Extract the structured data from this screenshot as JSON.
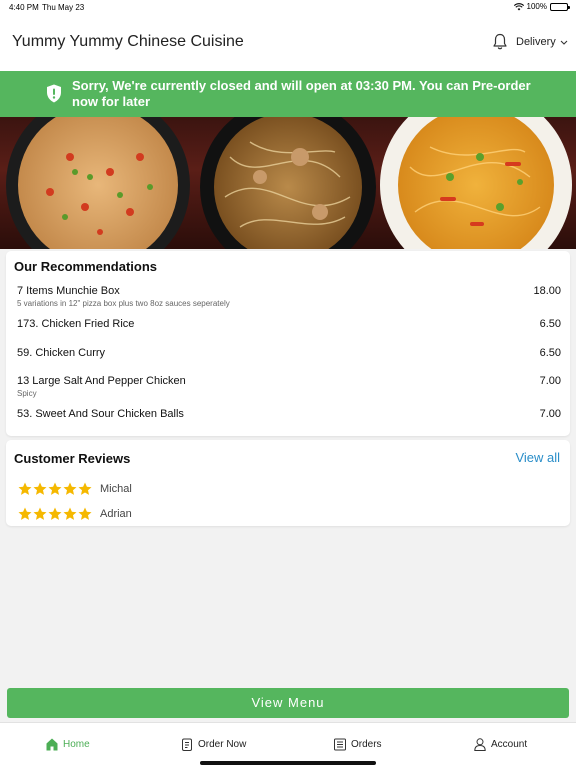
{
  "status_bar": {
    "time": "4:40 PM",
    "date": "Thu May 23",
    "battery": "100%"
  },
  "header": {
    "title": "Yummy Yummy Chinese Cuisine",
    "delivery_label": "Delivery",
    "bell_icon": "bell-icon"
  },
  "banner": {
    "message": "Sorry, We're currently closed and will open at 03:30 PM. You can Pre-order now for later",
    "icon": "shield-exclamation-icon"
  },
  "recommendations": {
    "title": "Our Recommendations",
    "items": [
      {
        "name": "7 Items Munchie Box",
        "desc": "5 variations in 12\" pizza box plus two 8oz sauces seperately",
        "price": "18.00"
      },
      {
        "name": "173. Chicken Fried Rice",
        "desc": "",
        "price": "6.50"
      },
      {
        "name": "59. Chicken Curry",
        "desc": "",
        "price": "6.50"
      },
      {
        "name": "13 Large Salt And Pepper Chicken",
        "desc": "Spicy",
        "price": "7.00"
      },
      {
        "name": "53. Sweet And Sour Chicken Balls",
        "desc": "",
        "price": "7.00"
      }
    ]
  },
  "reviews": {
    "title": "Customer Reviews",
    "view_all": "View all",
    "items": [
      {
        "name": "Michal",
        "rating": 5
      },
      {
        "name": "Adrian",
        "rating": 5
      }
    ]
  },
  "view_menu_label": "View Menu",
  "tabs": [
    {
      "label": "Home",
      "icon": "home-icon",
      "active": true
    },
    {
      "label": "Order Now",
      "icon": "order-icon",
      "active": false
    },
    {
      "label": "Orders",
      "icon": "orders-list-icon",
      "active": false
    },
    {
      "label": "Account",
      "icon": "person-icon",
      "active": false
    }
  ],
  "colors": {
    "accent_green": "#55b65e",
    "link_blue": "#2a8ec9",
    "star_gold": "#f5b800"
  }
}
